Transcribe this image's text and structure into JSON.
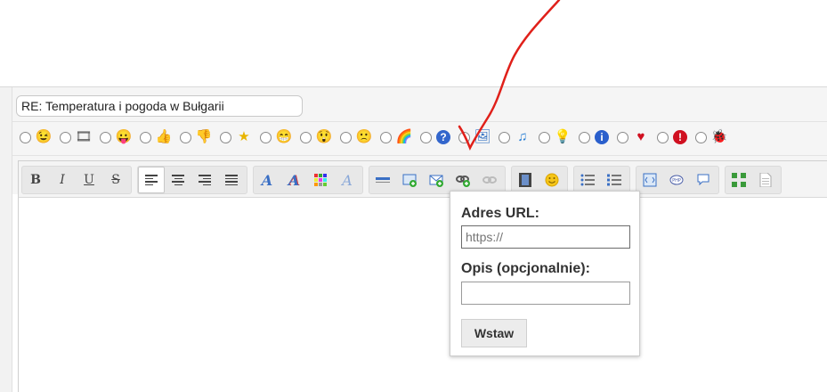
{
  "subject": {
    "value": "RE: Temperatura i pogoda w Bułgarii"
  },
  "smilies": [
    {
      "icon": "smile-face-icon",
      "glyph": "😉",
      "color": "#e8a400"
    },
    {
      "icon": "film-icon",
      "glyph": "🎞",
      "color": "#555"
    },
    {
      "icon": "tongue-face-icon",
      "glyph": "😛",
      "color": "#e8a400"
    },
    {
      "icon": "thumb-up-icon",
      "glyph": "👍",
      "color": "#d68a3a"
    },
    {
      "icon": "thumb-down-icon",
      "glyph": "👎",
      "color": "#d68a3a"
    },
    {
      "icon": "star-icon",
      "glyph": "★",
      "color": "#e8b400"
    },
    {
      "icon": "grin-face-icon",
      "glyph": "😁",
      "color": "#e8a400"
    },
    {
      "icon": "shock-face-icon",
      "glyph": "😲",
      "color": "#e8a400"
    },
    {
      "icon": "sad-face-icon",
      "glyph": "🙁",
      "color": "#e8a400"
    },
    {
      "icon": "rainbow-icon",
      "glyph": "🌈",
      "color": "#e05050"
    },
    {
      "icon": "question-icon",
      "glyph": "?",
      "color": "#3366cc"
    },
    {
      "icon": "image-icon",
      "glyph": "🖼",
      "color": "#3a76c4"
    },
    {
      "icon": "music-note-icon",
      "glyph": "♫",
      "color": "#2a7fd4"
    },
    {
      "icon": "lightbulb-icon",
      "glyph": "💡",
      "color": "#e8c000"
    },
    {
      "icon": "info-icon",
      "glyph": "i",
      "color": "#2a5fcc"
    },
    {
      "icon": "heart-icon",
      "glyph": "♥",
      "color": "#d01020"
    },
    {
      "icon": "warning-icon",
      "glyph": "!",
      "color": "#d01020"
    },
    {
      "icon": "bug-icon",
      "glyph": "🐞",
      "color": "#3a9a3a"
    }
  ],
  "toolbar": {
    "bold": "B",
    "italic": "I",
    "underline": "U",
    "strike": "S"
  },
  "popup": {
    "url_label": "Adres URL:",
    "url_placeholder": "https://",
    "desc_label": "Opis (opcjonalnie):",
    "desc_value": "",
    "insert_button": "Wstaw"
  },
  "colors": {
    "annotation_arrow": "#e0201a"
  }
}
